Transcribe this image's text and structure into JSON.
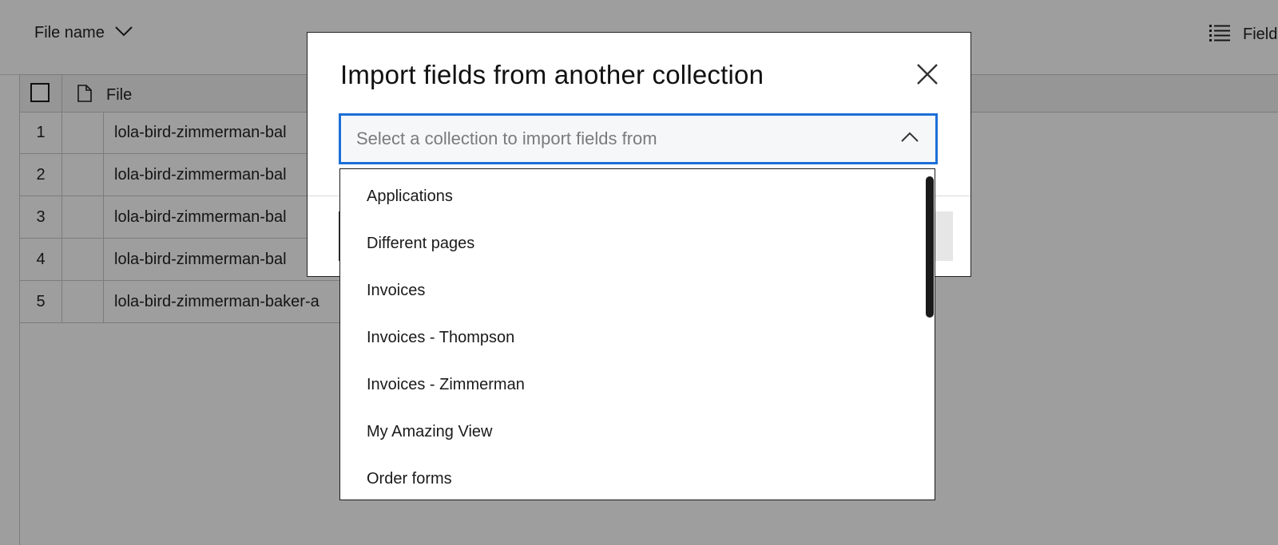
{
  "toolbar": {
    "sort_label": "File name",
    "sort_chevron_icon": "chevron-down-icon",
    "fields_icon": "list-icon",
    "fields_label": "Fields"
  },
  "table": {
    "header": {
      "file_label": "File",
      "file_icon": "document-icon"
    },
    "rows": [
      {
        "number": "1",
        "name": "lola-bird-zimmerman-bal"
      },
      {
        "number": "2",
        "name": "lola-bird-zimmerman-bal"
      },
      {
        "number": "3",
        "name": "lola-bird-zimmerman-bal"
      },
      {
        "number": "4",
        "name": "lola-bird-zimmerman-bal"
      },
      {
        "number": "5",
        "name": "lola-bird-zimmerman-baker-a"
      }
    ]
  },
  "modal": {
    "title": "Import fields from another collection",
    "close_icon": "close-icon",
    "select": {
      "placeholder": "Select a collection to import fields from",
      "chevron_icon": "chevron-up-icon",
      "accent_color": "#1b6fd8"
    },
    "options": [
      "Applications",
      "Different pages",
      "Invoices",
      "Invoices - Thompson",
      "Invoices - Zimmerman",
      "My Amazing View",
      "Order forms"
    ]
  }
}
